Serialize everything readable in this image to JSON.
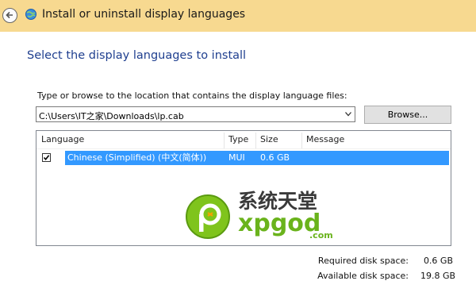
{
  "window": {
    "title": "Install or uninstall display languages"
  },
  "heading": "Select the display languages to install",
  "path": {
    "label": "Type or browse to the location that contains the display language files:",
    "value": "C:\\Users\\IT之家\\Downloads\\lp.cab",
    "browse_label": "Browse..."
  },
  "table": {
    "columns": [
      "Language",
      "Type",
      "Size",
      "Message"
    ],
    "rows": [
      {
        "checked": true,
        "language": "Chinese (Simplified) (中文(简体))",
        "type": "MUI",
        "size": "0.6 GB",
        "message": ""
      }
    ]
  },
  "disk": {
    "required_label": "Required disk space:",
    "required_value": "0.6 GB",
    "available_label": "Available disk space:",
    "available_value": "19.8 GB"
  },
  "watermark": {
    "name": "系统天堂",
    "brand": "xpgod",
    "domain": ".com"
  },
  "colors": {
    "titlebar": "#f7d990",
    "heading": "#1f3f8f",
    "selection": "#3399ff"
  },
  "icons": [
    "back-arrow-icon",
    "language-app-icon",
    "chevron-down-icon",
    "checkmark-icon",
    "xpgod-logo-icon"
  ]
}
